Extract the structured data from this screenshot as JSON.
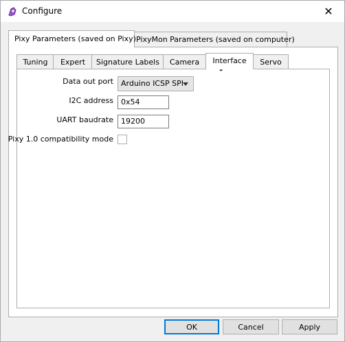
{
  "window": {
    "title": "Configure",
    "close_glyph": "✕"
  },
  "outer_tabs": [
    {
      "label": "Pixy Parameters (saved on Pixy)",
      "active": true
    },
    {
      "label": "PixyMon Parameters (saved on computer)",
      "active": false
    }
  ],
  "inner_tabs": [
    {
      "label": "Tuning",
      "active": false
    },
    {
      "label": "Expert",
      "active": false
    },
    {
      "label": "Signature Labels",
      "active": false
    },
    {
      "label": "Camera",
      "active": false
    },
    {
      "label": "Interface",
      "active": true
    },
    {
      "label": "Servo",
      "active": false
    }
  ],
  "interface": {
    "data_out_port": {
      "label": "Data out port",
      "value": "Arduino ICSP SPI"
    },
    "i2c_address": {
      "label": "I2C address",
      "value": "0x54"
    },
    "uart_baudrate": {
      "label": "UART baudrate",
      "value": "19200"
    },
    "pixy1_compat": {
      "label": "Pixy 1.0 compatibility mode",
      "checked": false
    }
  },
  "buttons": {
    "ok": "OK",
    "cancel": "Cancel",
    "apply": "Apply"
  },
  "icons": {
    "app": "pixy-app-icon",
    "close": "close-icon",
    "dropdown": "chevron-down-icon",
    "cursor": "mouse-cursor-icon"
  }
}
